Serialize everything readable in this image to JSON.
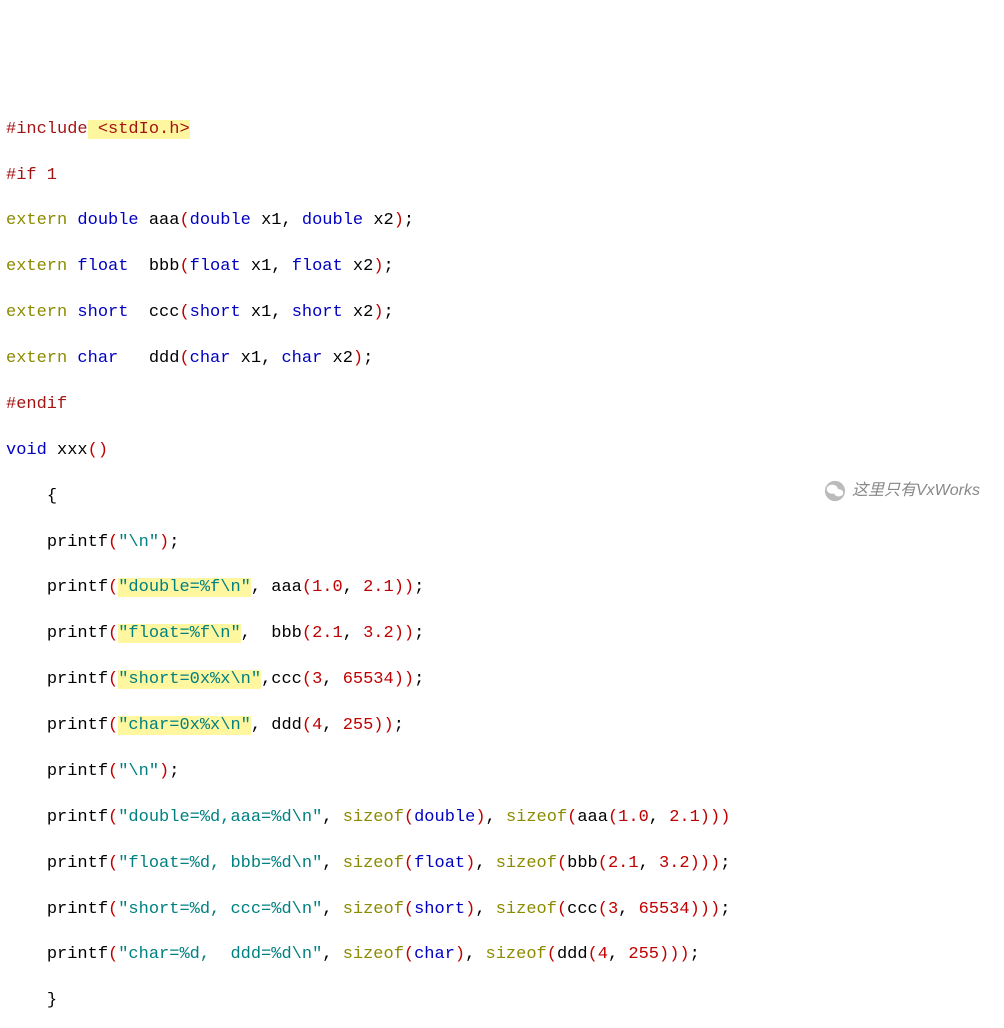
{
  "pp": {
    "include": "#include",
    "include_hdr": " <stdIo.h>",
    "if1": "#if 1",
    "endif": "#endif"
  },
  "kw": {
    "extern": "extern",
    "double": "double",
    "float": "float",
    "short": "short",
    "char": "char",
    "void": "void",
    "sizeof": "sizeof"
  },
  "fn": {
    "aaa": "aaa",
    "bbb": "bbb",
    "ccc": "ccc",
    "ddd": "ddd",
    "xxx": "xxx",
    "printf": "printf"
  },
  "param": {
    "x1": "x1",
    "x2": "x2"
  },
  "str": {
    "nl": "\"\\n\"",
    "double_f": "\"double=%f\\n\"",
    "float_f": "\"float=%f\\n\"",
    "short_x": "\"short=0x%x\\n\"",
    "char_x": "\"char=0x%x\\n\"",
    "double_d": "\"double=%d,aaa=%d\\n\"",
    "float_d": "\"float=%d, bbb=%d\\n\"",
    "short_d": "\"short=%d, ccc=%d\\n\"",
    "char_d": "\"char=%d,  ddd=%d\\n\""
  },
  "num": {
    "n1_0": "1.0",
    "n2_1": "2.1",
    "n3_2": "3.2",
    "n3": "3",
    "n65534": "65534",
    "n4": "4",
    "n255": "255"
  },
  "watermark": "这里只有VxWorks"
}
